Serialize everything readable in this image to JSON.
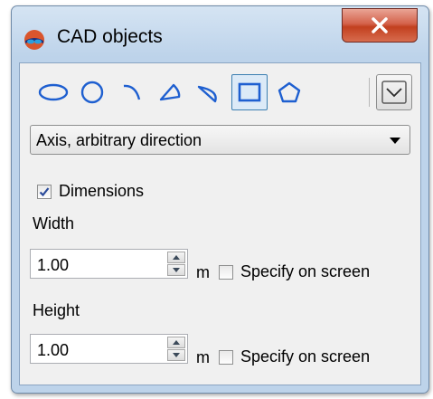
{
  "window": {
    "title": "CAD objects",
    "close_glyph": "X"
  },
  "toolbar": {
    "shapes": [
      {
        "icon": "ellipse-icon"
      },
      {
        "icon": "circle-icon"
      },
      {
        "icon": "arc-icon"
      },
      {
        "icon": "sector-icon"
      },
      {
        "icon": "segment-icon"
      },
      {
        "icon": "rectangle-icon",
        "selected": true
      },
      {
        "icon": "polygon-icon"
      }
    ],
    "menu_icon": "chevron-down-icon"
  },
  "mode": {
    "selected": "Axis, arbitrary direction"
  },
  "dimensions": {
    "label": "Dimensions",
    "checked": true
  },
  "width": {
    "label": "Width",
    "value": "1.00",
    "unit": "m",
    "specify_label": "Specify on screen",
    "specify_checked": false
  },
  "height": {
    "label": "Height",
    "value": "1.00",
    "unit": "m",
    "specify_label": "Specify on screen",
    "specify_checked": false
  },
  "colors": {
    "icon_blue": "#1e5fd0",
    "selection_border": "#3c7fb1",
    "close_red": "#c2401f"
  }
}
